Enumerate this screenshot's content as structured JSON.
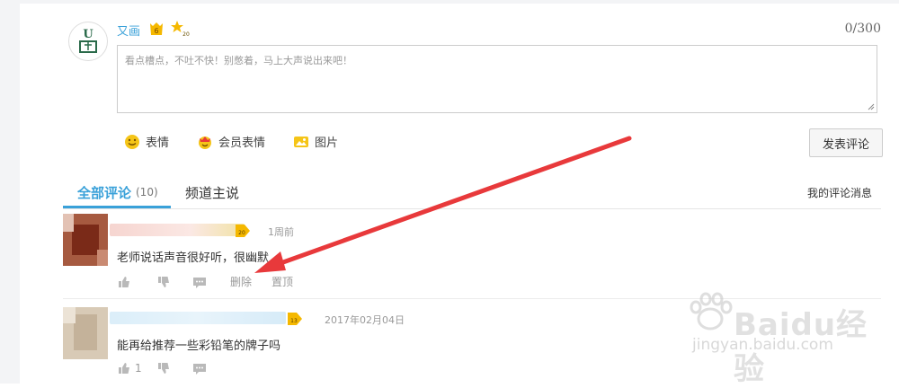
{
  "composer": {
    "username": "又画",
    "level": "6",
    "vip_level": "20",
    "char_count": "0/300",
    "placeholder": "看点槽点，不吐不快！别憋着，马上大声说出来吧！",
    "toolbar": [
      {
        "label": "表情",
        "icon": "smile-icon"
      },
      {
        "label": "会员表情",
        "icon": "vip-emoji-icon"
      },
      {
        "label": "图片",
        "icon": "image-icon"
      }
    ],
    "submit_label": "发表评论"
  },
  "tabs": {
    "all_label": "全部评论",
    "all_count": "(10)",
    "channel_label": "频道主说",
    "my_messages_label": "我的评论消息"
  },
  "comments": [
    {
      "badge": "20",
      "time": "1周前",
      "text": "老师说话声音很好听，很幽默",
      "actions": {
        "like_count": "",
        "delete_label": "删除",
        "pin_label": "置顶"
      }
    },
    {
      "badge": "13",
      "time": "2017年02月04日",
      "text": "能再给推荐一些彩铅笔的牌子吗",
      "actions": {
        "like_count": "1"
      }
    }
  ],
  "watermark": {
    "brand": "Baidu经验",
    "url": "jingyan.baidu.com"
  },
  "colors": {
    "accent": "#3aa1d9",
    "arrow": "#e8393b",
    "badge_gold": "#f5b800"
  }
}
